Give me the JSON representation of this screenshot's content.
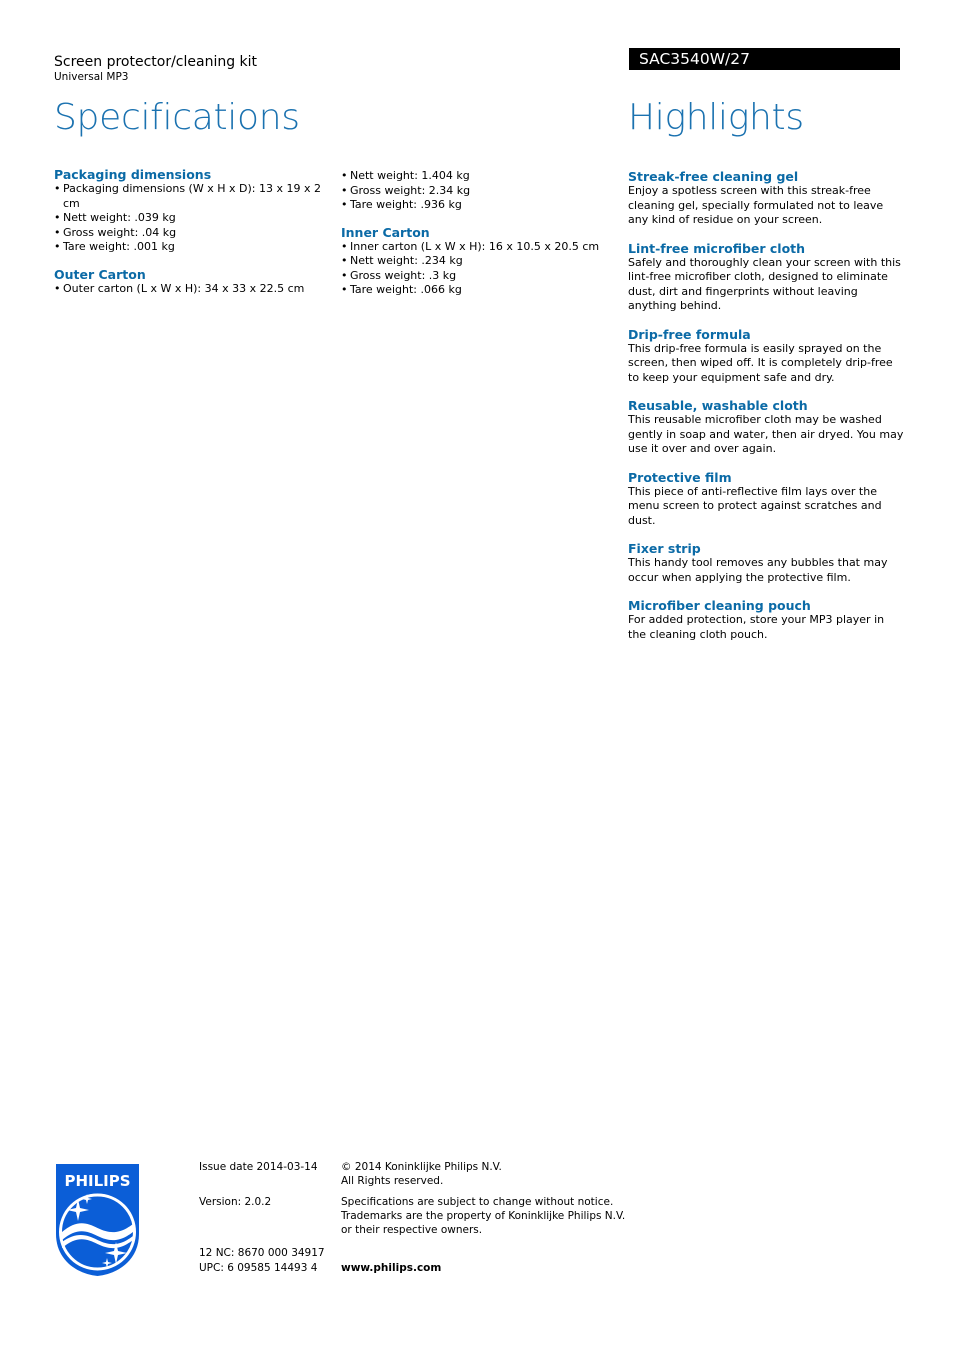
{
  "header": {
    "product_name": "Screen protector/cleaning kit",
    "product_subtitle": "Universal MP3",
    "model": "SAC3540W/27",
    "specifications_title": "Specifications",
    "highlights_title": "Highlights"
  },
  "specifications": {
    "packaging_dimensions": {
      "title": "Packaging dimensions",
      "items": [
        "Packaging dimensions (W x H x D): 13 x 19 x 2 cm",
        "Nett weight: .039 kg",
        "Gross weight: .04 kg",
        "Tare weight: .001 kg"
      ]
    },
    "outer_carton": {
      "title": "Outer Carton",
      "items": [
        "Outer carton (L x W x H): 34 x 33 x 22.5 cm",
        "Nett weight: 1.404 kg",
        "Gross weight: 2.34 kg",
        "Tare weight: .936 kg"
      ]
    },
    "inner_carton": {
      "title": "Inner Carton",
      "items": [
        "Inner carton (L x W x H): 16 x 10.5 x 20.5 cm",
        "Nett weight: .234 kg",
        "Gross weight: .3 kg",
        "Tare weight: .066 kg"
      ]
    }
  },
  "highlights": [
    {
      "title": "Streak-free cleaning gel",
      "text": "Enjoy a spotless screen with this streak-free cleaning gel, specially formulated not to leave any kind of residue on your screen."
    },
    {
      "title": "Lint-free microfiber cloth",
      "text": "Safely and thoroughly clean your screen with this lint-free microfiber cloth, designed to eliminate dust, dirt and fingerprints without leaving anything behind."
    },
    {
      "title": "Drip-free formula",
      "text": "This drip-free formula is easily sprayed on the screen, then wiped off. It is completely drip-free to keep your equipment safe and dry."
    },
    {
      "title": "Reusable, washable cloth",
      "text": "This reusable microfiber cloth may be washed gently in soap and water, then air dryed. You may use it over and over again."
    },
    {
      "title": "Protective film",
      "text": "This piece of anti-reflective film lays over the menu screen to protect against scratches and dust."
    },
    {
      "title": "Fixer strip",
      "text": "This handy tool removes any bubbles that may occur when applying the protective film."
    },
    {
      "title": "Microfiber cleaning pouch",
      "text": "For added protection, store your MP3 player in the cleaning cloth pouch."
    }
  ],
  "footer": {
    "logo_text": "PHILIPS",
    "logo_icon": "philips-shield-logo",
    "issue_date": "Issue date 2014-03-14",
    "copyright_line1": "© 2014 Koninklijke Philips N.V.",
    "copyright_line2": "All Rights reserved.",
    "version": "Version: 2.0.2",
    "spec_note_line1": "Specifications are subject to change without notice.",
    "spec_note_line2": "Trademarks are the property of Koninklijke Philips N.V.",
    "spec_note_line3": "or their respective owners.",
    "nc": "12 NC: 8670 000 34917",
    "upc": "UPC: 6 09585 14493 4",
    "website": "www.philips.com"
  },
  "colors": {
    "accent_blue": "#1b72b0",
    "heading_blue": "#0b6aa6",
    "logo_blue": "#0b5ed7",
    "model_bar": "#000000"
  }
}
